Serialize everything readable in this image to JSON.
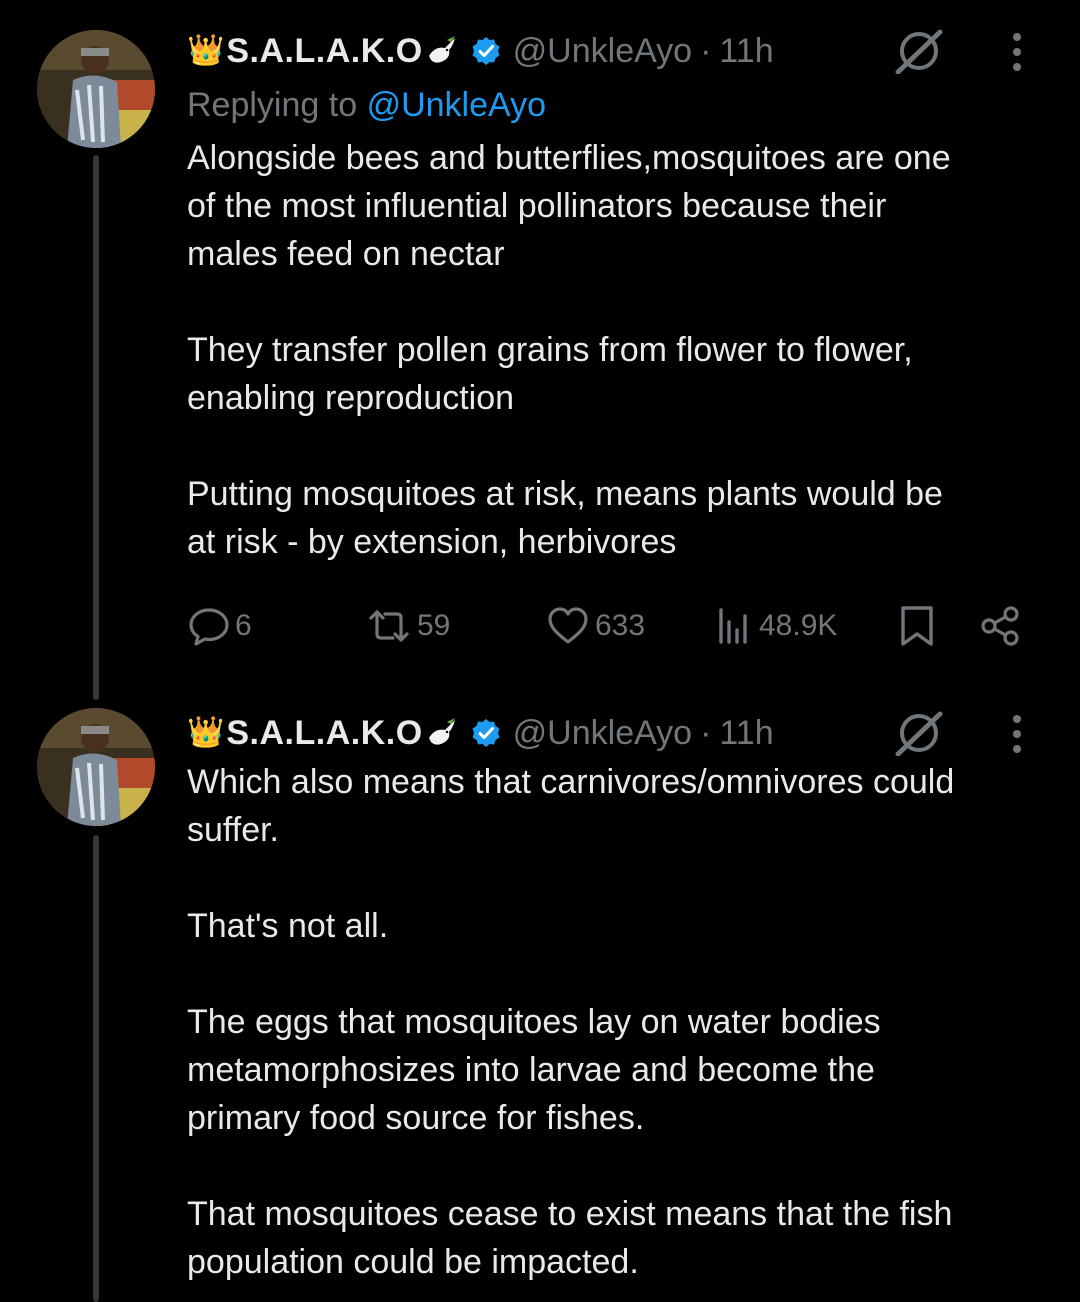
{
  "tweets": [
    {
      "crown": "👑",
      "display_name": "S.A.L.A.K.O",
      "handle": "@UnkleAyo",
      "dot": "·",
      "time": "11h",
      "replying_prefix": "Replying to",
      "replying_to": "@UnkleAyo",
      "paragraphs": [
        "Alongside bees and butterflies,mosquitoes are one\nof the most influential pollinators because their\nmales feed on nectar",
        "They transfer pollen grains from flower to flower,\nenabling reproduction",
        "Putting mosquitoes at risk, means plants would be\nat risk - by extension, herbivores"
      ],
      "stats": {
        "replies": "6",
        "reposts": "59",
        "likes": "633",
        "views": "48.9K"
      }
    },
    {
      "crown": "👑",
      "display_name": "S.A.L.A.K.O",
      "handle": "@UnkleAyo",
      "dot": "·",
      "time": "11h",
      "paragraphs": [
        "Which also means that carnivores/omnivores could\nsuffer.",
        "That's not all.",
        "The eggs that mosquitoes lay on water bodies\nmetamorphosizes into larvae and become the\nprimary food source for fishes.",
        "That mosquitoes cease to exist means that the fish\npopulation could be impacted."
      ]
    }
  ],
  "icons": {
    "reply": "reply-bubble-icon",
    "repost": "repost-icon",
    "like": "heart-icon",
    "views": "views-bar-chart-icon",
    "bookmark": "bookmark-icon",
    "share": "share-icon",
    "grok": "grok-icon",
    "more": "more-dots-icon",
    "verified": "verified-badge-icon",
    "dove": "dove-icon"
  },
  "colors": {
    "background": "#000000",
    "text": "#e7e9ea",
    "secondary_text": "#71767b",
    "link": "#1d9bf0",
    "verified": "#1d9bf0",
    "thread_line": "#333639"
  }
}
